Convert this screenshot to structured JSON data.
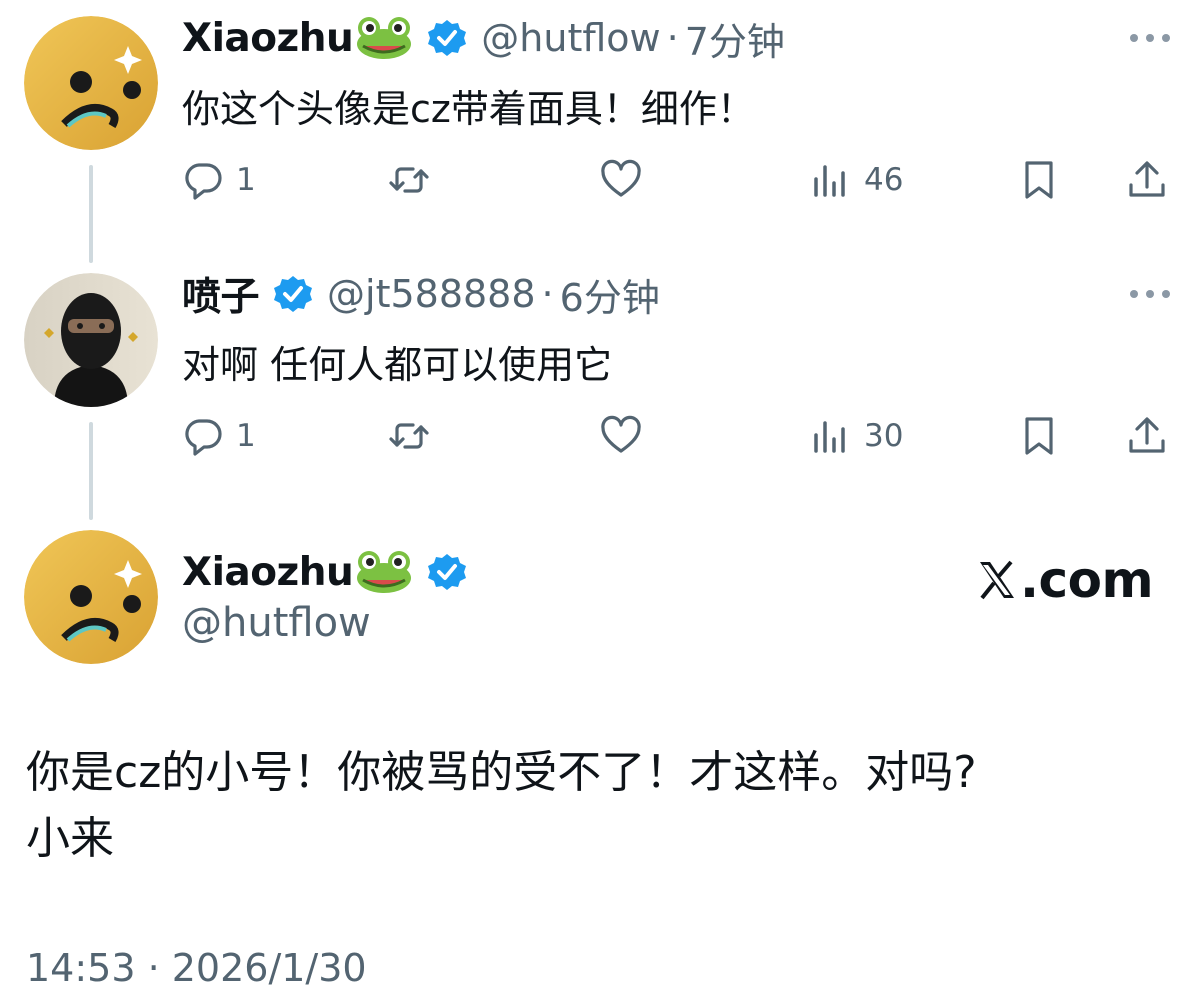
{
  "replies": [
    {
      "display_name": "Xiaozhu",
      "name_emoji": "frog-emoji",
      "verified": true,
      "handle": "@hutflow",
      "separator": "·",
      "time": "7分钟",
      "text": "你这个头像是cz带着面具！细作！",
      "stats": {
        "replies": "1",
        "retweets": "",
        "likes": "",
        "views": "46"
      }
    },
    {
      "display_name": "喷子",
      "verified": true,
      "handle": "@jt588888",
      "separator": "·",
      "time": "6分钟",
      "text": "对啊 任何人都可以使用它",
      "stats": {
        "replies": "1",
        "retweets": "",
        "likes": "",
        "views": "30"
      }
    }
  ],
  "main_tweet": {
    "display_name": "Xiaozhu",
    "name_emoji": "frog-emoji",
    "verified": true,
    "handle": "@hutflow",
    "brand": ".com",
    "brand_icon": "x-logo-icon",
    "text_lines": [
      "你是cz的小号！你被骂的受不了！才这样。对吗?",
      "小来"
    ],
    "timestamp": "14:53 · 2026/1/30"
  },
  "colors": {
    "accent_verified": "#1d9bf0",
    "muted": "#536471",
    "text": "#0f1419",
    "thread_line": "#cfd9de"
  }
}
